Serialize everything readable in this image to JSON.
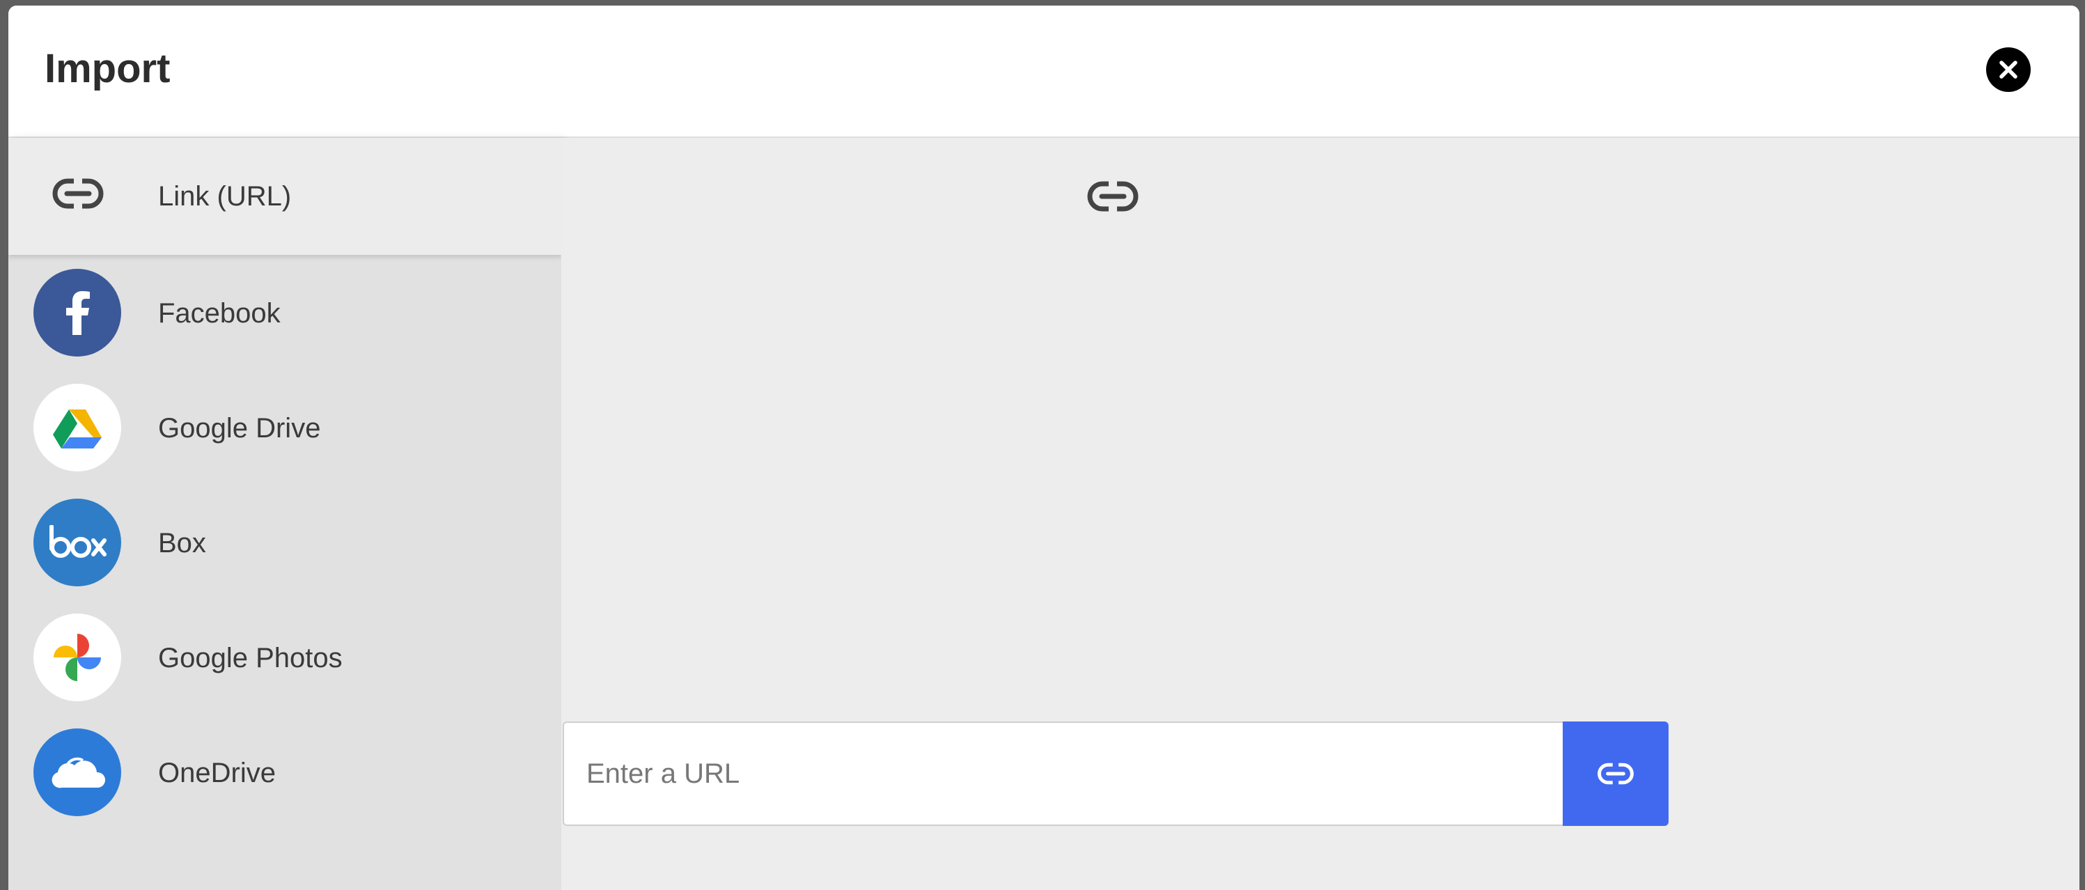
{
  "dialog": {
    "title": "Import",
    "close_icon": "close-icon"
  },
  "sidebar": {
    "items": [
      {
        "label": "Link (URL)",
        "icon": "link-icon",
        "active": true
      },
      {
        "label": "Facebook",
        "icon": "facebook-icon",
        "color": "#3b5998"
      },
      {
        "label": "Google Drive",
        "icon": "google-drive-icon",
        "color": "#ffffff"
      },
      {
        "label": "Box",
        "icon": "box-icon",
        "color": "#2f7dc6"
      },
      {
        "label": "Google Photos",
        "icon": "google-photos-icon",
        "color": "#ffffff"
      },
      {
        "label": "OneDrive",
        "icon": "onedrive-icon",
        "color": "#2d7bd8"
      }
    ]
  },
  "main": {
    "header_icon": "link-icon",
    "url_input": {
      "placeholder": "Enter a URL",
      "value": ""
    },
    "submit_icon": "link-icon",
    "submit_color": "#4169f0"
  }
}
